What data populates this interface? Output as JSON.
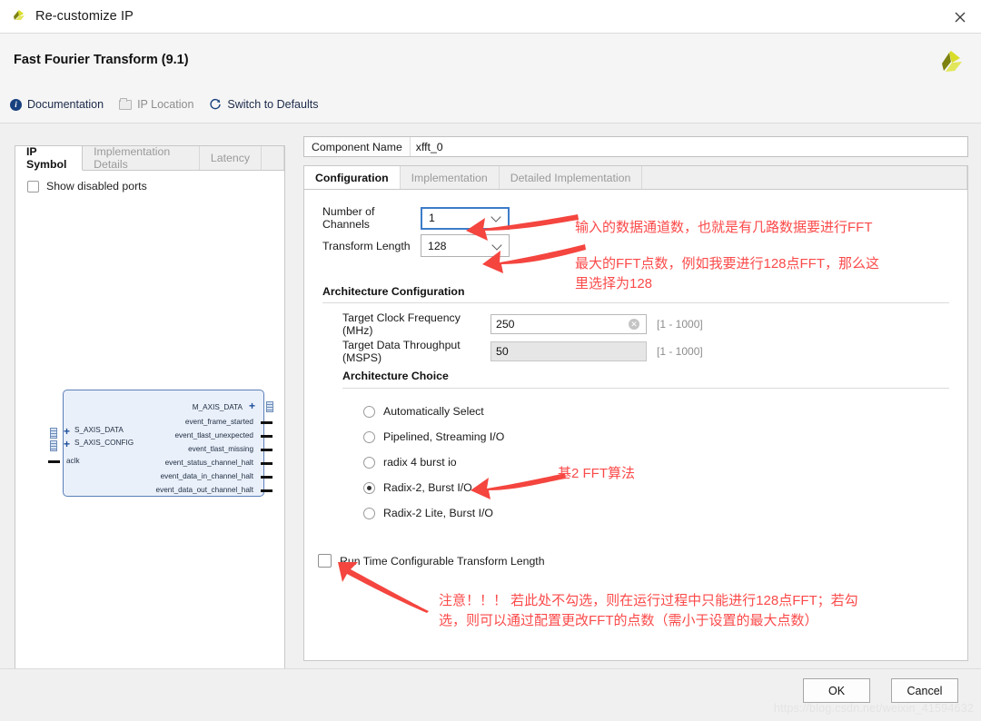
{
  "window": {
    "title": "Re-customize IP",
    "close_label": "✕",
    "logo_icon": "xilinx-logo-icon"
  },
  "header": {
    "ip_title": "Fast Fourier Transform (9.1)",
    "toolbar": [
      {
        "label": "Documentation",
        "icon": "info-icon",
        "disabled": false
      },
      {
        "label": "IP Location",
        "icon": "folder-icon",
        "disabled": true
      },
      {
        "label": "Switch to Defaults",
        "icon": "refresh-icon",
        "disabled": false
      }
    ]
  },
  "left_panel": {
    "tabs": [
      {
        "label": "IP Symbol",
        "active": true
      },
      {
        "label": "Implementation Details",
        "active": false
      },
      {
        "label": "Latency",
        "active": false
      }
    ],
    "show_disabled_ports": {
      "label": "Show disabled ports",
      "checked": false
    },
    "symbol": {
      "input_ports": [
        "S_AXIS_DATA",
        "S_AXIS_CONFIG",
        "aclk"
      ],
      "output_ports": [
        "M_AXIS_DATA",
        "event_frame_started",
        "event_tlast_unexpected",
        "event_tlast_missing",
        "event_status_channel_halt",
        "event_data_in_channel_halt",
        "event_data_out_channel_halt"
      ]
    }
  },
  "right_panel": {
    "component_name": {
      "label": "Component Name",
      "value": "xfft_0"
    },
    "tabs": [
      {
        "label": "Configuration",
        "active": true
      },
      {
        "label": "Implementation",
        "active": false
      },
      {
        "label": "Detailed Implementation",
        "active": false
      }
    ],
    "number_of_channels": {
      "label": "Number of Channels",
      "value": "1"
    },
    "transform_length": {
      "label": "Transform Length",
      "value": "128"
    },
    "architecture_configuration": {
      "heading": "Architecture Configuration",
      "clock_frequency": {
        "label": "Target Clock Frequency (MHz)",
        "value": "250",
        "range": "[1 - 1000]"
      },
      "data_throughput": {
        "label": "Target Data Throughput (MSPS)",
        "value": "50",
        "range": "[1 - 1000]"
      }
    },
    "architecture_choice": {
      "heading": "Architecture Choice",
      "options": [
        {
          "label": "Automatically Select",
          "selected": false
        },
        {
          "label": "Pipelined, Streaming I/O",
          "selected": false
        },
        {
          "label": "radix 4 burst io",
          "selected": false
        },
        {
          "label": "Radix-2, Burst I/O",
          "selected": true
        },
        {
          "label": "Radix-2 Lite, Burst I/O",
          "selected": false
        }
      ]
    },
    "run_time_configurable": {
      "label": "Run Time Configurable Transform Length",
      "checked": false
    }
  },
  "annotations": {
    "channels_note": "输入的数据通道数，也就是有几路数据要进行FFT",
    "length_note": "最大的FFT点数，例如我要进行128点FFT，那么这\n里选择为128",
    "radix_note": "基2 FFT算法",
    "runtime_note": "注意！！！ 若此处不勾选，则在运行过程中只能进行128点FFT；若勾\n选，则可以通过配置更改FFT的点数（需小于设置的最大点数）",
    "color": "#fb4a4a"
  },
  "footer": {
    "ok_label": "OK",
    "cancel_label": "Cancel",
    "watermark": "https://blog.csdn.net/weixin_41594632"
  }
}
